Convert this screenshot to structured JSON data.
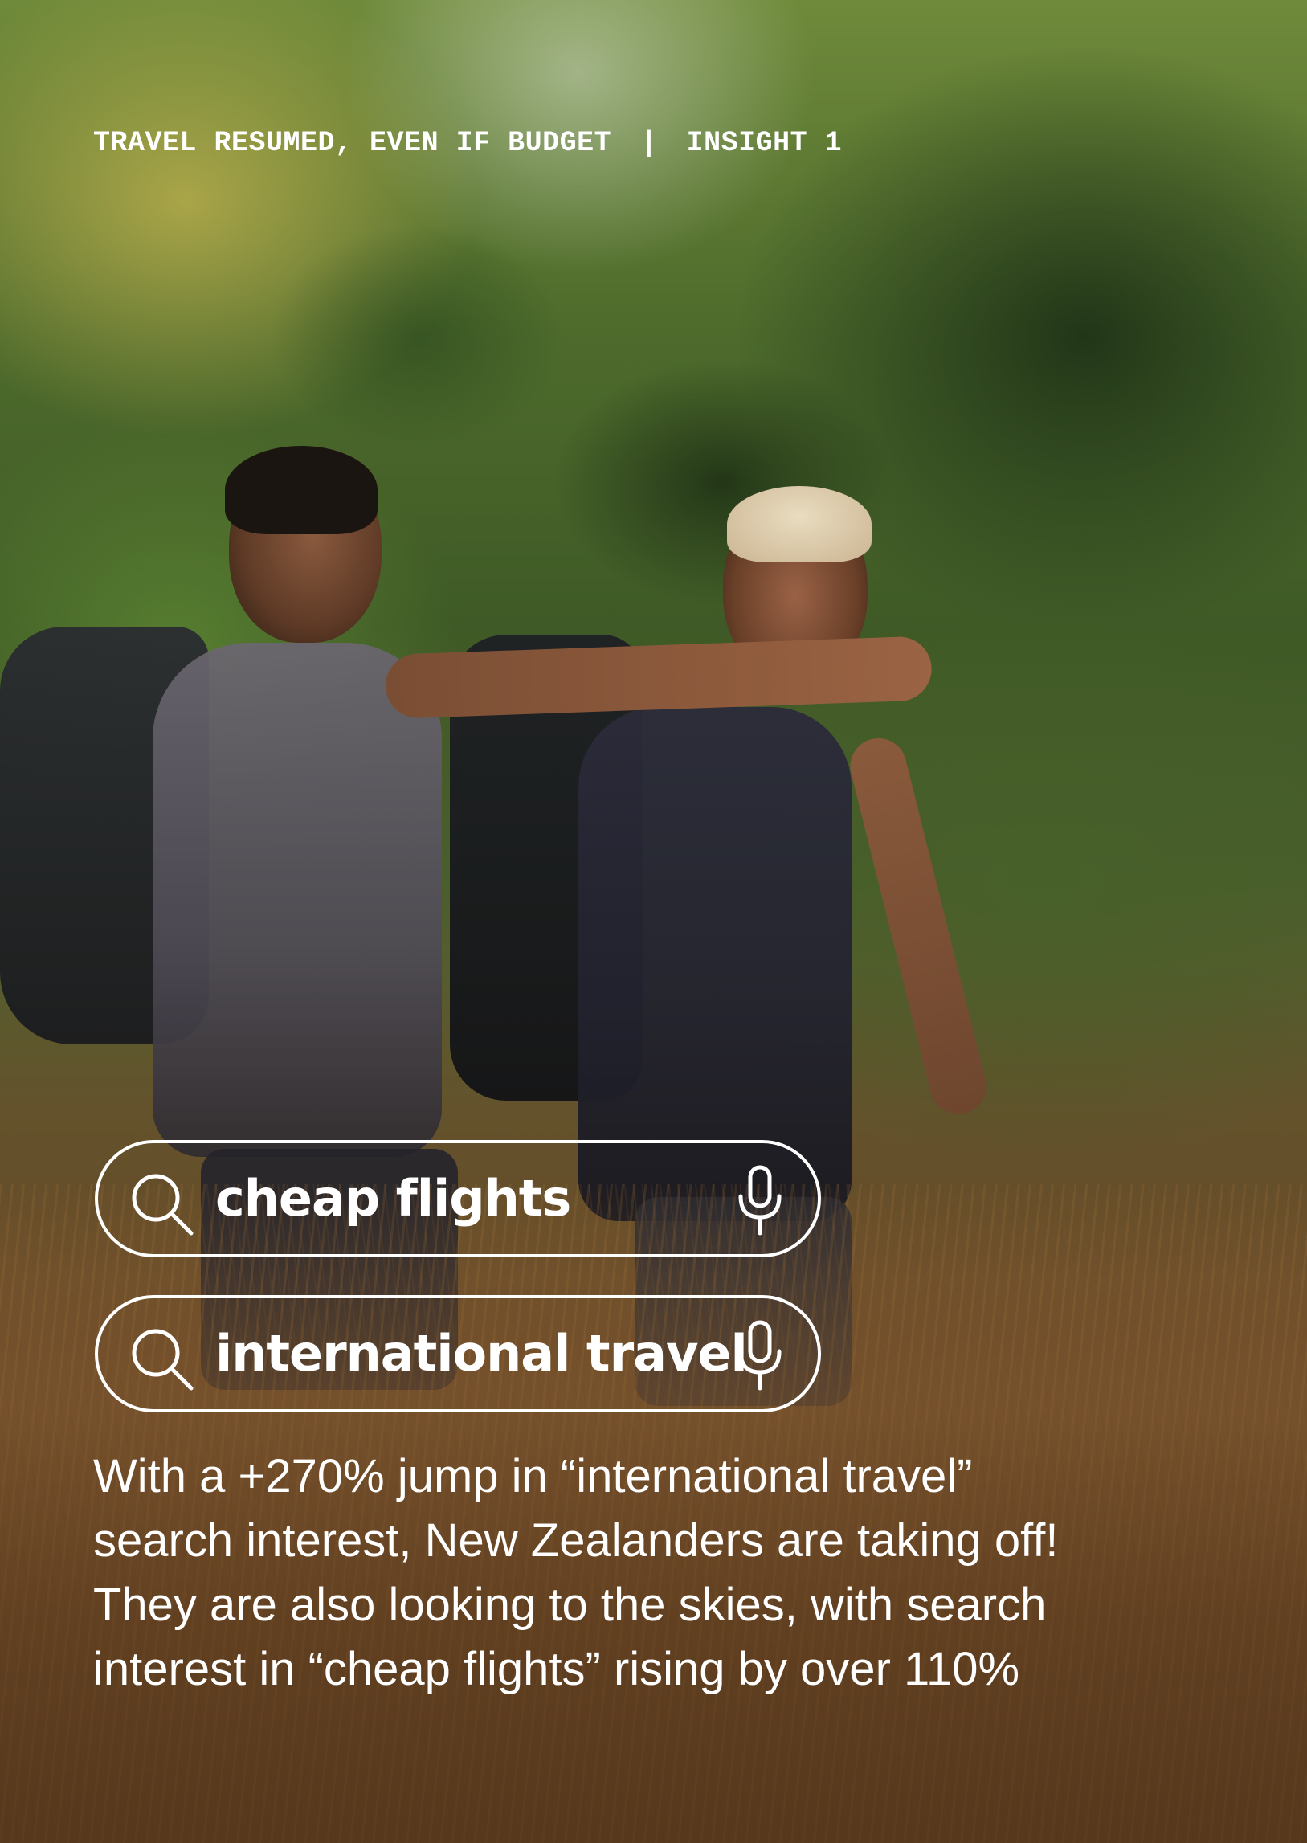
{
  "eyebrow": {
    "section": "TRAVEL RESUMED, EVEN IF BUDGET",
    "separator": "|",
    "insight": "INSIGHT 1"
  },
  "searches": [
    {
      "query": "cheap flights",
      "icon": "search-icon",
      "trailing_icon": "microphone-icon"
    },
    {
      "query": "international travel",
      "icon": "search-icon",
      "trailing_icon": "microphone-icon"
    }
  ],
  "body": {
    "lines": [
      "With a +270% jump in “international travel”",
      "search interest, New Zealanders are taking off!",
      "They are also looking to the skies, with search",
      "interest in “cheap flights” rising by over 110%"
    ]
  },
  "colors": {
    "text": "#ffffff",
    "outline": "#ffffff"
  }
}
